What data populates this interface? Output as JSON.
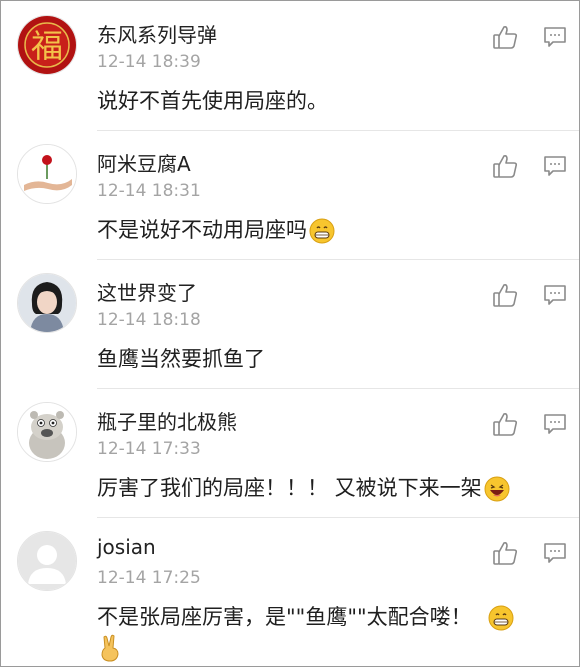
{
  "comments": [
    {
      "username": "东风系列导弹",
      "timestamp": "12-14 18:39",
      "text": "说好不首先使用局座的。",
      "avatar_icon": "fu-character-avatar"
    },
    {
      "username": "阿米豆腐A",
      "timestamp": "12-14 18:31",
      "text": "不是说好不动用局座吗",
      "avatar_icon": "rose-in-hand-avatar",
      "emoji": "grinning-emoji"
    },
    {
      "username": "这世界变了",
      "timestamp": "12-14 18:18",
      "text": "鱼鹰当然要抓鱼了",
      "avatar_icon": "girl-portrait-avatar"
    },
    {
      "username": "瓶子里的北极熊",
      "timestamp": "12-14 17:33",
      "text": "厉害了我们的局座！！！ 又被说下来一架",
      "avatar_icon": "cartoon-bear-avatar",
      "emoji": "laughing-emoji"
    },
    {
      "username": "josian",
      "timestamp": "12-14 17:25",
      "text": "不是张局座厉害，是\"\"鱼鹰\"\"太配合喽！",
      "avatar_icon": "default-user-avatar",
      "emoji": "grinning-emoji",
      "emoji2": "victory-hand-emoji"
    }
  ],
  "icons": {
    "like": "thumbs-up-icon",
    "reply": "comment-icon"
  },
  "colors": {
    "text": "#222222",
    "timestamp": "#a4a4a4",
    "icon": "#8a8a8a",
    "divider": "#e6e6e6"
  }
}
